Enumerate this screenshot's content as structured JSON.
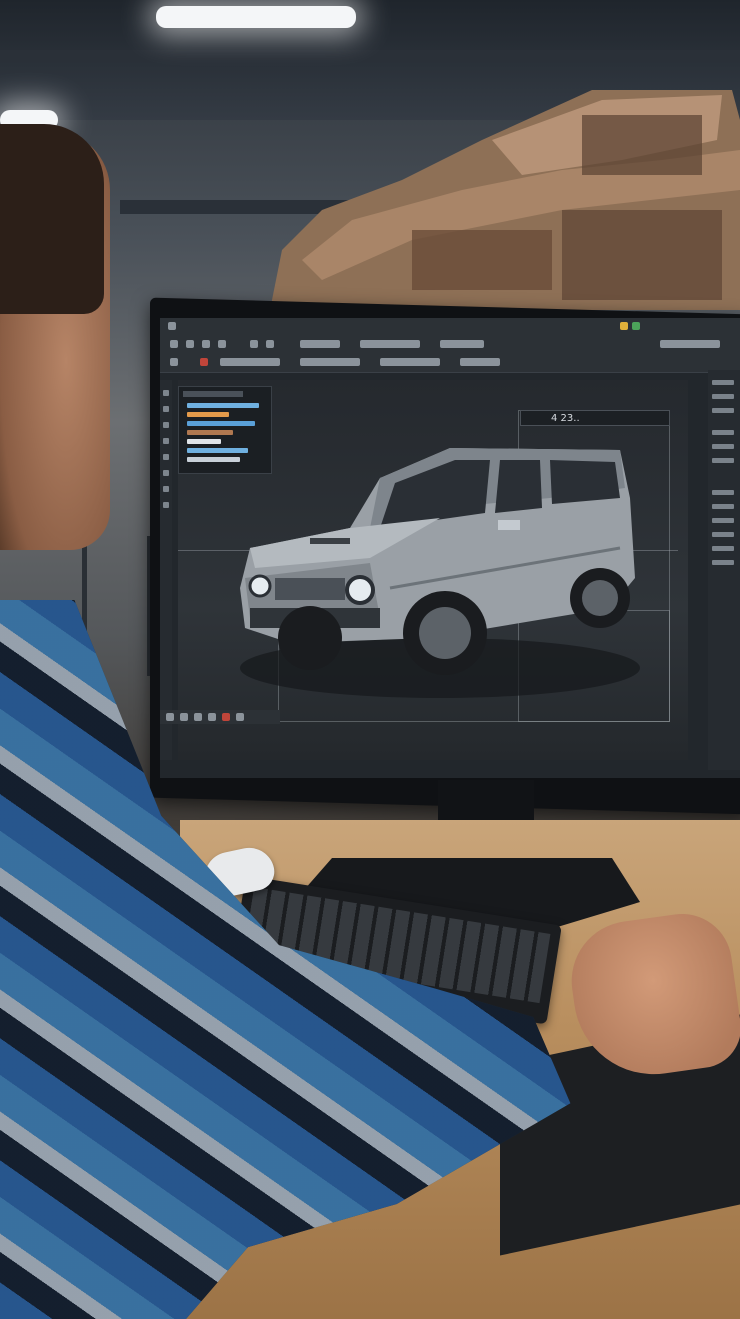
{
  "scene": {
    "colors": {
      "screen_bg": "#22272c",
      "suv_body": "#9aa0a6",
      "desk_wood": "#c9a57a",
      "shirt_blue": "#285a96"
    }
  },
  "screen": {
    "readout_text": "4 23..",
    "icons": [
      "select-tool-icon",
      "move-tool-icon",
      "rotate-tool-icon",
      "scale-tool-icon",
      "camera-icon",
      "render-icon"
    ]
  },
  "layers": {
    "bars": [
      {
        "color": "#6fb0e0",
        "fill": 0.95
      },
      {
        "color": "#e39a4a",
        "fill": 0.55
      },
      {
        "color": "#5aa0d8",
        "fill": 0.9
      },
      {
        "color": "#b07850",
        "fill": 0.6
      },
      {
        "color": "#e0e4e8",
        "fill": 0.45
      },
      {
        "color": "#6fb0e0",
        "fill": 0.8
      },
      {
        "color": "#c8d0d8",
        "fill": 0.7
      }
    ]
  }
}
